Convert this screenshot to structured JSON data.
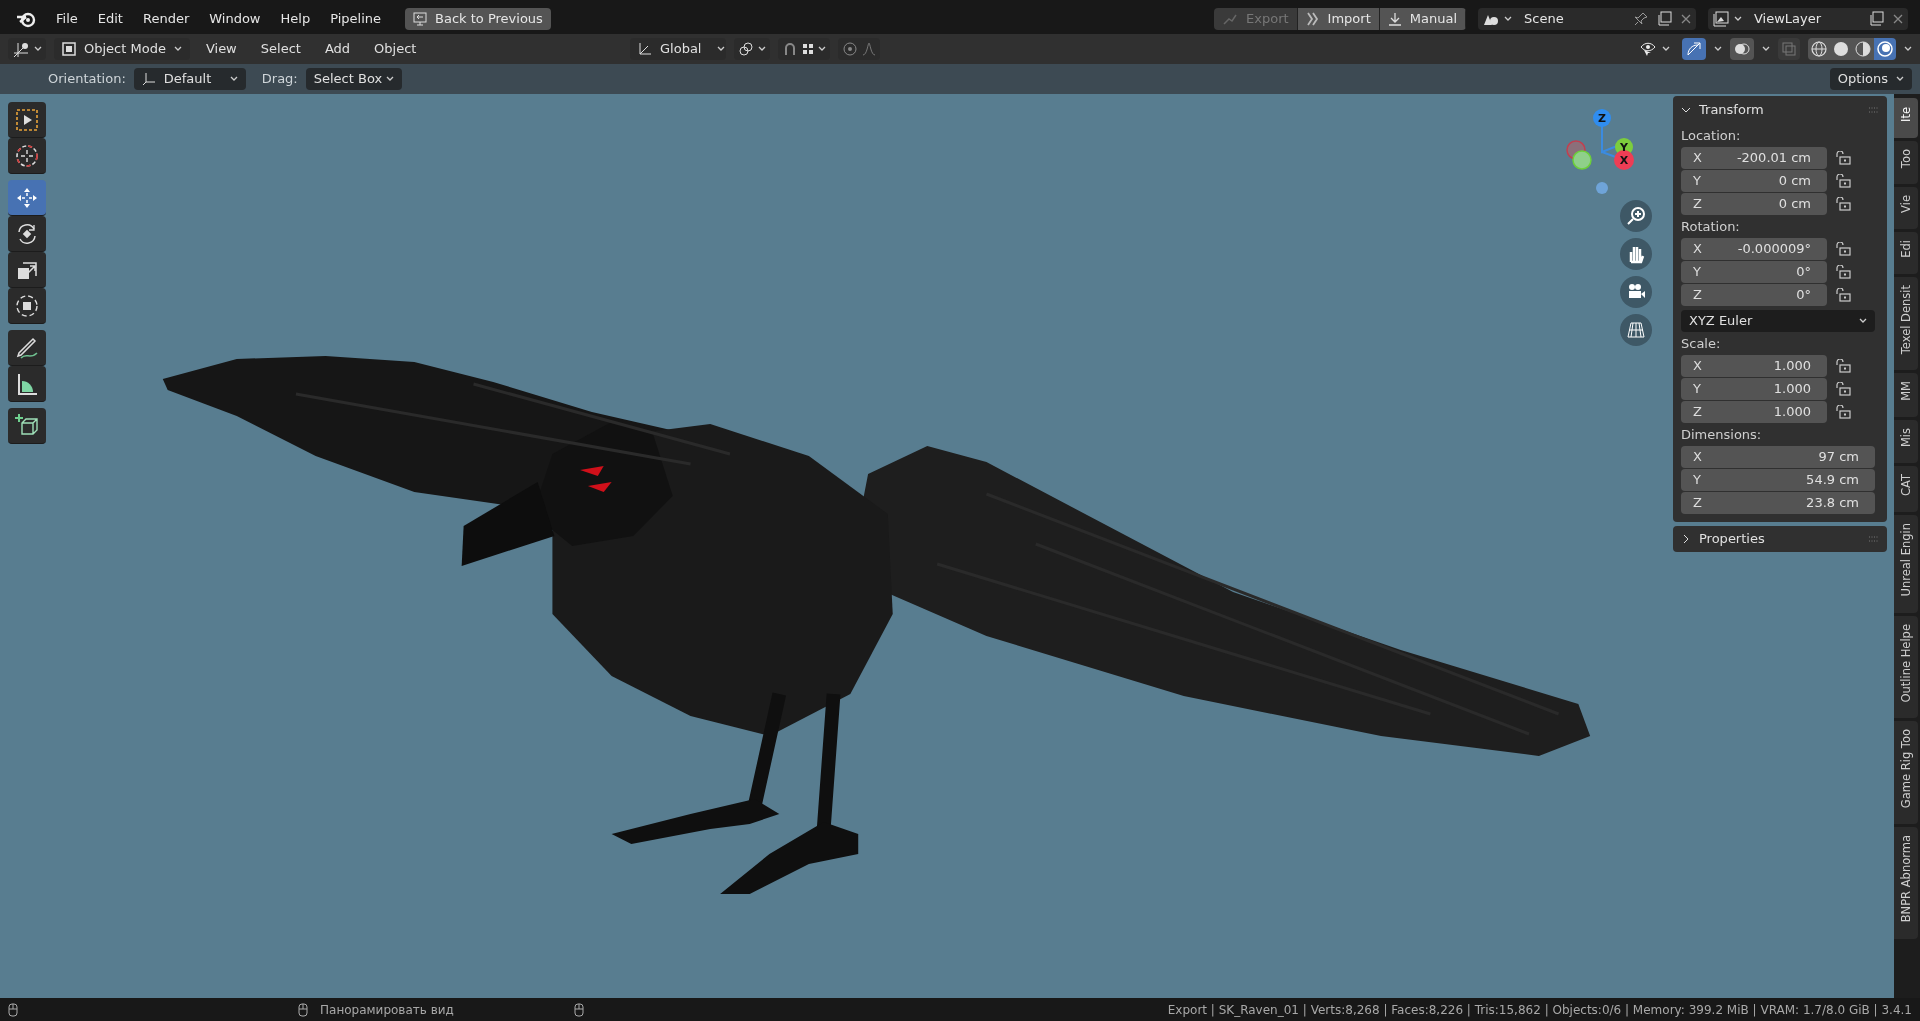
{
  "top_bar": {
    "menus": [
      "File",
      "Edit",
      "Render",
      "Window",
      "Help",
      "Pipeline"
    ],
    "back_button": "Back to Previous",
    "pipeline_buttons": [
      {
        "label": "Export",
        "disabled": true,
        "kind": "export"
      },
      {
        "label": "Import",
        "disabled": false,
        "kind": "import"
      },
      {
        "label": "Manual",
        "disabled": false,
        "kind": "manual"
      }
    ],
    "scene": "Scene",
    "view_layer": "ViewLayer"
  },
  "header": {
    "mode": "Object Mode",
    "menus": [
      "View",
      "Select",
      "Add",
      "Object"
    ],
    "orientation": "Global",
    "shading": [
      {
        "kind": "wireframe",
        "selected": false
      },
      {
        "kind": "solid",
        "selected": false
      },
      {
        "kind": "material",
        "selected": false
      },
      {
        "kind": "rendered",
        "selected": true
      }
    ]
  },
  "tool_settings": {
    "orientation_label": "Orientation:",
    "orientation": "Default",
    "drag_label": "Drag:",
    "drag": "Select Box",
    "options": "Options"
  },
  "toolbar": [
    {
      "kind": "select",
      "selected": false
    },
    {
      "kind": "cursor",
      "selected": false
    },
    {
      "kind": "move",
      "selected": true
    },
    {
      "kind": "rotate",
      "selected": false
    },
    {
      "kind": "scale",
      "selected": false
    },
    {
      "kind": "transform",
      "selected": false
    },
    {
      "kind": "annotate",
      "selected": false
    },
    {
      "kind": "measure",
      "selected": false
    },
    {
      "kind": "add-cube",
      "selected": false
    }
  ],
  "gizmo": {
    "z": "Z",
    "y": "Y",
    "x": "X"
  },
  "transform_panel": {
    "title": "Transform",
    "expanded": true,
    "sections": [
      {
        "label": "Location:",
        "locks": true,
        "rows": [
          {
            "axis": "X",
            "value": "-200.01 cm"
          },
          {
            "axis": "Y",
            "value": "0 cm"
          },
          {
            "axis": "Z",
            "value": "0 cm"
          }
        ]
      },
      {
        "label": "Rotation:",
        "locks": true,
        "rows": [
          {
            "axis": "X",
            "value": "-0.000009°"
          },
          {
            "axis": "Y",
            "value": "0°"
          },
          {
            "axis": "Z",
            "value": "0°"
          }
        ],
        "mode": "XYZ Euler"
      },
      {
        "label": "Scale:",
        "locks": true,
        "rows": [
          {
            "axis": "X",
            "value": "1.000"
          },
          {
            "axis": "Y",
            "value": "1.000"
          },
          {
            "axis": "Z",
            "value": "1.000"
          }
        ]
      },
      {
        "label": "Dimensions:",
        "locks": false,
        "rows": [
          {
            "axis": "X",
            "value": "97 cm"
          },
          {
            "axis": "Y",
            "value": "54.9 cm"
          },
          {
            "axis": "Z",
            "value": "23.8 cm"
          }
        ]
      }
    ]
  },
  "properties_panel": {
    "title": "Properties",
    "expanded": false
  },
  "side_tabs": [
    {
      "label": "Ite",
      "selected": true
    },
    {
      "label": "Too",
      "selected": false
    },
    {
      "label": "Vie",
      "selected": false
    },
    {
      "label": "Edi",
      "selected": false
    },
    {
      "label": "Texel Densit",
      "selected": false
    },
    {
      "label": "MM",
      "selected": false
    },
    {
      "label": "Mis",
      "selected": false
    },
    {
      "label": "CAT",
      "selected": false
    },
    {
      "label": "Unreal Engin",
      "selected": false
    },
    {
      "label": "Outline Helpe",
      "selected": false
    },
    {
      "label": "Game Rig Too",
      "selected": false
    },
    {
      "label": "BNPR Abnorma",
      "selected": false
    }
  ],
  "status_bar": {
    "hint": "Панорамировать вид",
    "stats": "Export | SK_Raven_01 | Verts:8,268 | Faces:8,226 | Tris:15,862 | Objects:0/6 | Memory: 399.2 MiB | VRAM: 1.7/8.0 GiB | 3.4.1"
  }
}
